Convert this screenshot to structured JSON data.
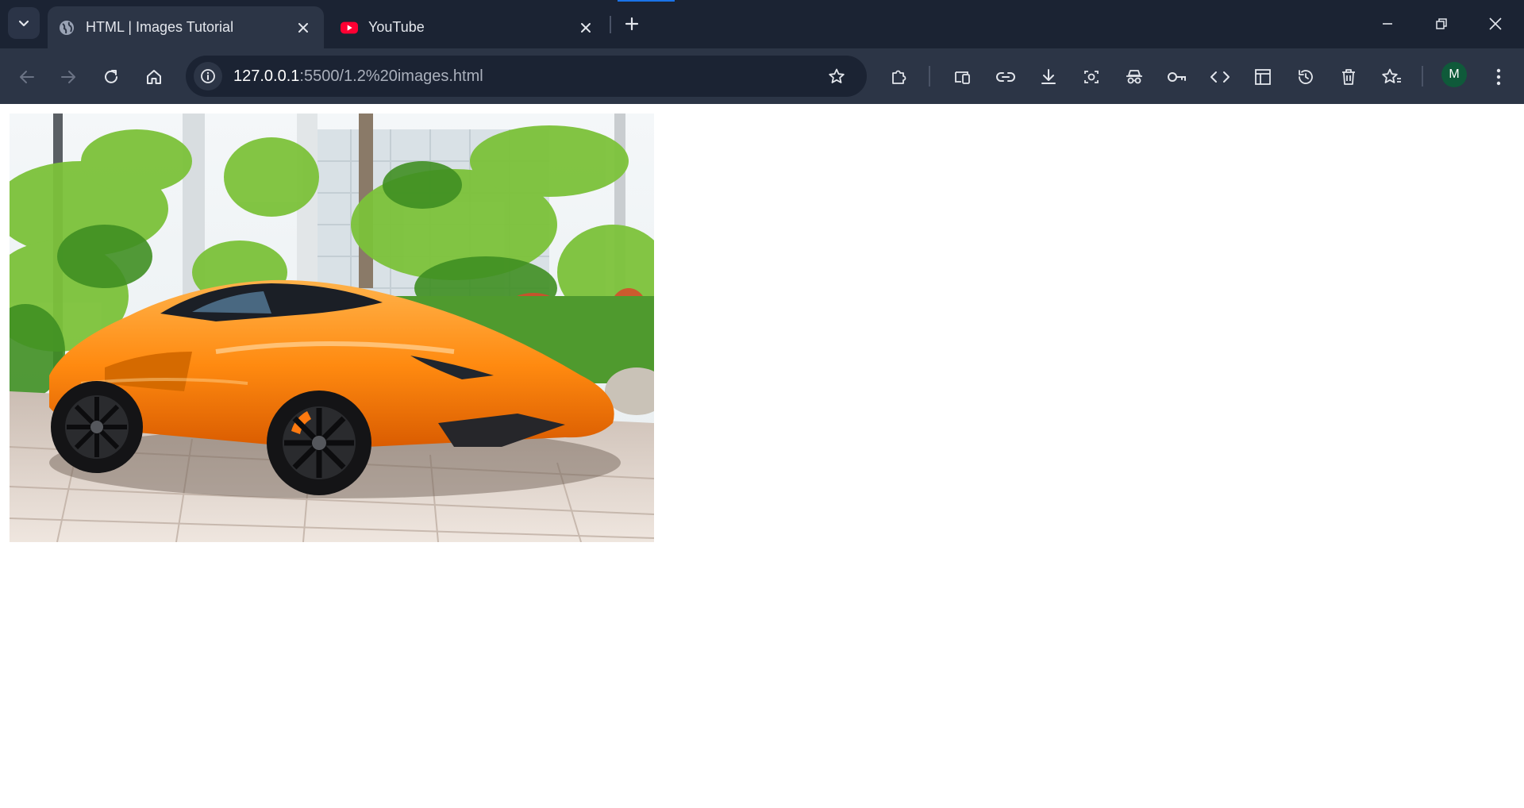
{
  "tabs": [
    {
      "title": "HTML | Images Tutorial",
      "favicon": "globe-icon",
      "active": true
    },
    {
      "title": "YouTube",
      "favicon": "youtube-icon",
      "active": false
    }
  ],
  "address_bar": {
    "host": "127.0.0.1",
    "rest": ":5500/1.2%20images.html"
  },
  "profile": {
    "initial": "M"
  },
  "page": {
    "image_alt": "orange sports car parked among palm trees"
  },
  "colors": {
    "tabstrip_bg": "#1b2333",
    "toolbar_bg": "#2c3546",
    "accent": "#1a73e8",
    "youtube_red": "#ff0033",
    "avatar_bg": "#0f5a3a"
  }
}
